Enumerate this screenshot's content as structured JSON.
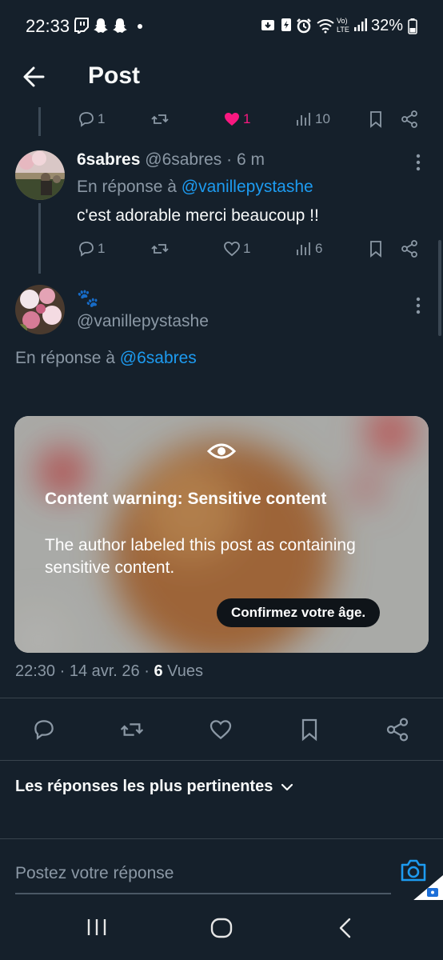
{
  "status_bar": {
    "time": "22:33",
    "battery": "32%"
  },
  "header": {
    "title": "Post"
  },
  "prev_tweet_actions": {
    "replies": "1",
    "likes": "1",
    "views": "10",
    "like_color": "#f91880"
  },
  "reply_tweet": {
    "name": "6sabres",
    "handle": "@6sabres",
    "time": "· 6 m",
    "replying_prefix": "En réponse à",
    "replying_to": "@vanillepystashe",
    "text": "c'est adorable merci beaucoup !!",
    "actions": {
      "replies": "1",
      "likes": "1",
      "views": "6"
    }
  },
  "main_tweet": {
    "name_emoji": "🐾",
    "handle": "@vanillepystashe",
    "replying_prefix": "En réponse à",
    "replying_to": "@6sabres",
    "warning_title": "Content warning: Sensitive content",
    "warning_desc": "The author labeled this post as containing sensitive content.",
    "confirm_button": "Confirmez votre âge.",
    "timestamp": "22:30 · 14 avr. 26 ·",
    "views_count": "6",
    "views_label": "Vues"
  },
  "sort": {
    "label": "Les réponses les plus pertinentes"
  },
  "reply_box": {
    "placeholder": "Postez votre réponse"
  },
  "colors": {
    "background": "#15202b",
    "accent": "#1d9bf0",
    "muted": "#8b98a5"
  }
}
